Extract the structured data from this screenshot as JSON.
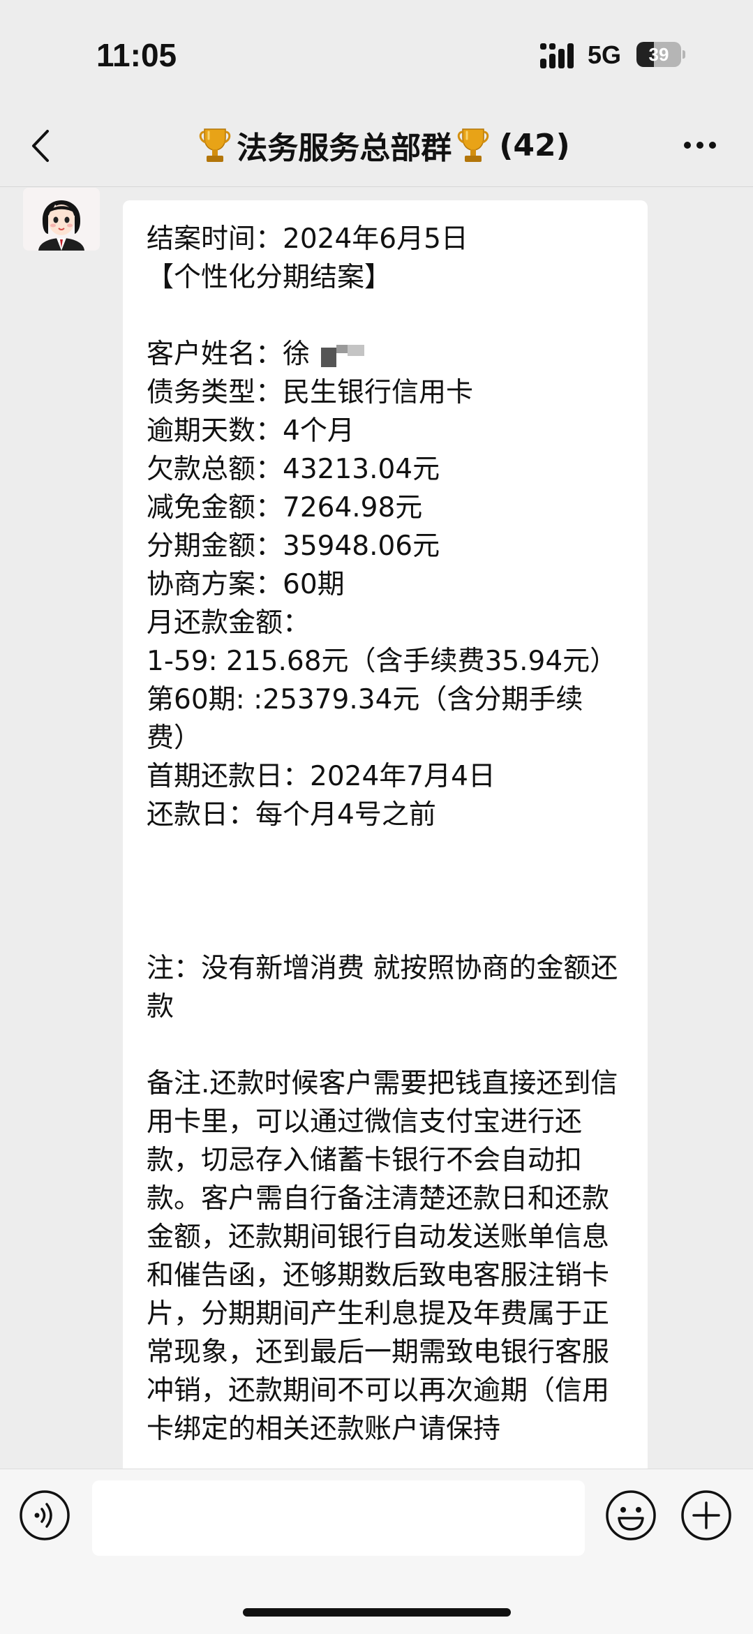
{
  "status_bar": {
    "time": "11:05",
    "network": "5G",
    "battery": "39",
    "battery_level": 0.39
  },
  "nav": {
    "title": "法务服务总部群",
    "member_count": "(42)",
    "icons": [
      "back-icon",
      "trophy-icon",
      "more-icon"
    ]
  },
  "chat": {
    "message": {
      "line_01": "结案时间：2024年6月5日",
      "line_02": "【个性化分期结案】",
      "line_03": "客户姓名：徐",
      "line_04": "债务类型：民生银行信用卡",
      "line_05": "逾期天数：4个月",
      "line_06": "欠款总额：43213.04元",
      "line_07": "减免金额：7264.98元",
      "line_08": "分期金额：35948.06元",
      "line_09": "协商方案：60期",
      "line_10": "月还款金额：",
      "line_11": "1-59: 215.68元（含手续费35.94元）",
      "line_12": "第60期: :25379.34元（含分期手续费）",
      "line_13": "首期还款日：2024年7月4日",
      "line_14": "还款日：每个月4号之前",
      "line_15": "注：没有新增消费 就按照协商的金额还款",
      "line_16": "备注.还款时候客户需要把钱直接还到信用卡里，可以通过微信支付宝进行还款，切忌存入储蓄卡银行不会自动扣款。客户需自行备注清楚还款日和还款金额，还款期间银行自动发送账单信息和催告函，还够期数后致电客服注销卡片，分期期间产生利息提及年费属于正常现象，还到最后一期需致电银行客服冲销，还款期间不可以再次逾期（信用卡绑定的相关还款账户请保持"
    }
  },
  "input_bar": {
    "icons": [
      "voice-icon",
      "emoji-icon",
      "plus-icon"
    ]
  }
}
